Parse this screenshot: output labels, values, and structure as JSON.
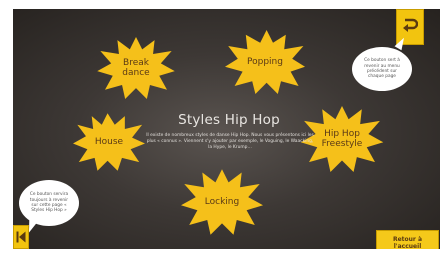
{
  "title": "Styles Hip Hop",
  "description": "Il existe de nombreux styles de danse Hip Hop. Nous vous présentons ici les plus « connus ». Viennent s'y ajouter par exemple, le Voguing, le Waacking, la Hype, le Krump…",
  "styles": {
    "breakdance": "Break\ndance",
    "popping": "Popping",
    "house": "House",
    "hiphop_freestyle": "Hip Hop\nFreestyle",
    "locking": "Locking"
  },
  "tooltips": {
    "back_top": "Ce bouton sert à revenir au menu précédent sur chaque page",
    "back_bottom": "Ce bouton servira toujours à revenir sur cette page « Styles Hip Hop »"
  },
  "home_button_label": "Retour à\nl'accueil",
  "colors": {
    "accent": "#f5c91a",
    "burst": "#f5c01a",
    "background": "#3d3835"
  },
  "icons": {
    "back_top": "u-turn-back-arrow-icon",
    "back_bottom": "skip-to-start-icon"
  }
}
